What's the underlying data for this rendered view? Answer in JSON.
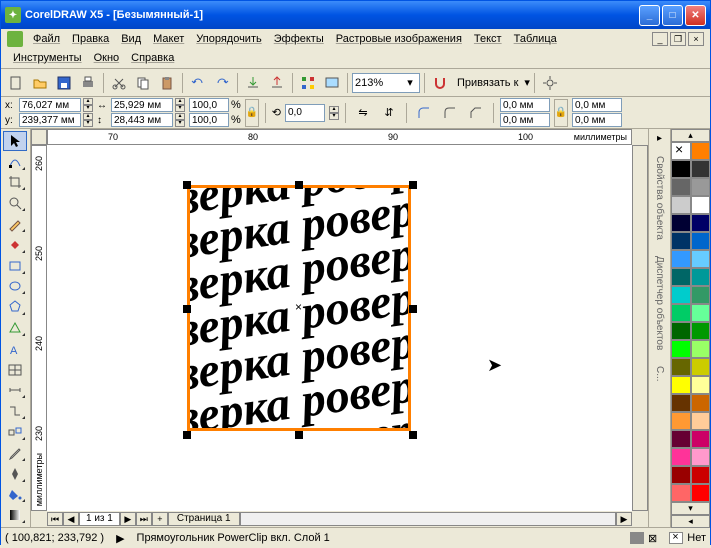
{
  "title": "CorelDRAW X5 - [Безымянный-1]",
  "menu": {
    "file": "Файл",
    "edit": "Правка",
    "view": "Вид",
    "layout": "Макет",
    "arrange": "Упорядочить",
    "effects": "Эффекты",
    "bitmaps": "Растровые изображения",
    "text": "Текст",
    "table": "Таблица",
    "tools": "Инструменты",
    "window": "Окно",
    "help": "Справка"
  },
  "zoom": "213%",
  "snap_label": "Привязать к",
  "props": {
    "x": "76,027 мм",
    "y": "239,377 мм",
    "w": "25,929 мм",
    "h": "28,443 мм",
    "sx": "100,0",
    "sy": "100,0",
    "rot": "0,0",
    "corner1": "0,0 мм",
    "corner2": "0,0 мм",
    "corner3": "0,0 мм",
    "corner4": "0,0 мм",
    "pct": "%"
  },
  "ruler": {
    "units": "миллиметры",
    "h_ticks": [
      "70",
      "80",
      "90",
      "100"
    ],
    "v_ticks": [
      "260",
      "250",
      "240",
      "230"
    ]
  },
  "page_nav": {
    "count": "1 из 1",
    "tab": "Страница 1"
  },
  "dockers": {
    "obj_props": "Свойства объекта",
    "obj_mgr": "Диспетчер объектов",
    "more": "С..."
  },
  "status": {
    "coords": "( 100,821; 233,792 )",
    "desc": "Прямоугольник PowerClip вкл. Слой 1",
    "outline": "Нет"
  },
  "clip_content": "роверка",
  "colors": [
    "none",
    "#ff7f00",
    "#000000",
    "#333333",
    "#666666",
    "#999999",
    "#cccccc",
    "#ffffff",
    "#000033",
    "#000066",
    "#003366",
    "#0066cc",
    "#3399ff",
    "#66ccff",
    "#006666",
    "#009999",
    "#00cccc",
    "#339966",
    "#00cc66",
    "#66ff99",
    "#006600",
    "#009900",
    "#00ff00",
    "#99ff66",
    "#666600",
    "#cccc00",
    "#ffff00",
    "#ffff99",
    "#663300",
    "#cc6600",
    "#ff9933",
    "#ffcc99",
    "#660033",
    "#cc0066",
    "#ff3399",
    "#ff99cc",
    "#990000",
    "#cc0000",
    "#ff6666",
    "#ff0000"
  ]
}
